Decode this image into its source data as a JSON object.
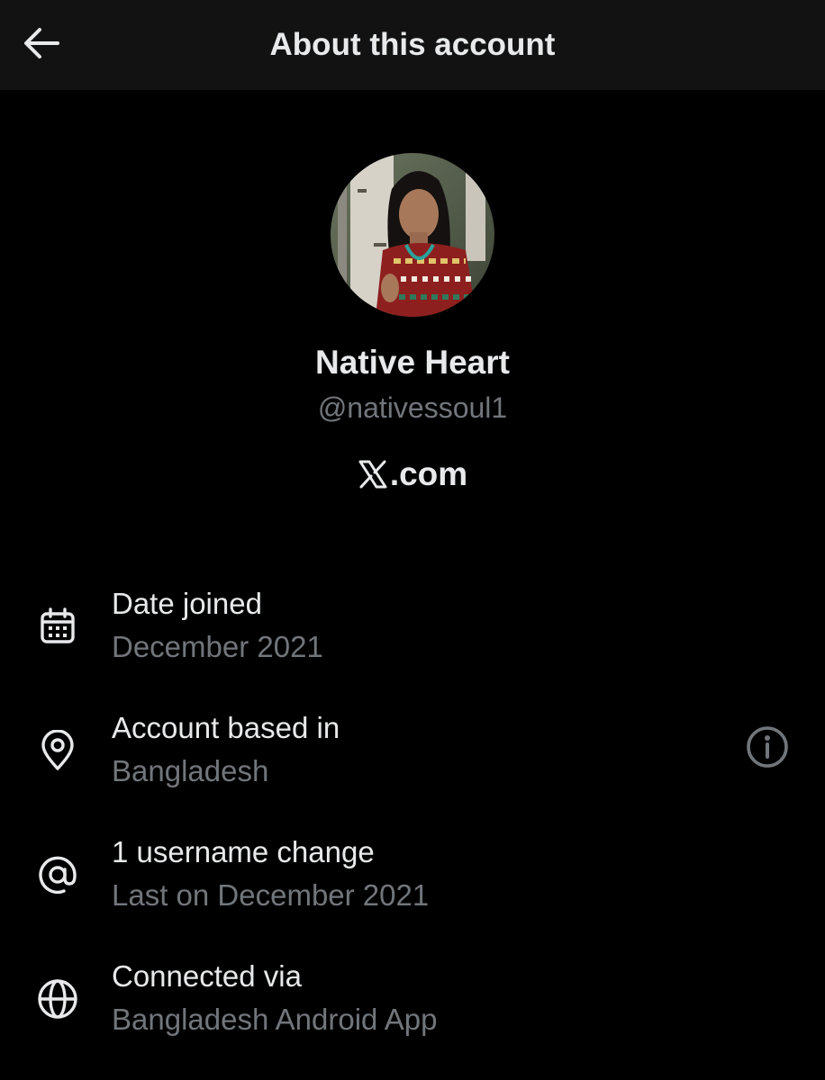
{
  "header": {
    "title": "About this account",
    "back_icon": "arrow-left-icon"
  },
  "profile": {
    "name": "Native Heart",
    "handle": "@nativessoul1",
    "platform_logo": "x-logo",
    "platform_suffix": ".com"
  },
  "details": [
    {
      "icon": "calendar-icon",
      "label": "Date joined",
      "value": "December 2021"
    },
    {
      "icon": "location-pin-icon",
      "label": "Account based in",
      "value": "Bangladesh",
      "action_icon": "info-icon"
    },
    {
      "icon": "at-sign-icon",
      "label": "1 username change",
      "value": "Last on December 2021"
    },
    {
      "icon": "globe-icon",
      "label": "Connected via",
      "value": "Bangladesh Android App"
    }
  ],
  "colors": {
    "background": "#000000",
    "header_background": "#121212",
    "primary_text": "#e7e9ea",
    "secondary_text": "#71767b"
  }
}
